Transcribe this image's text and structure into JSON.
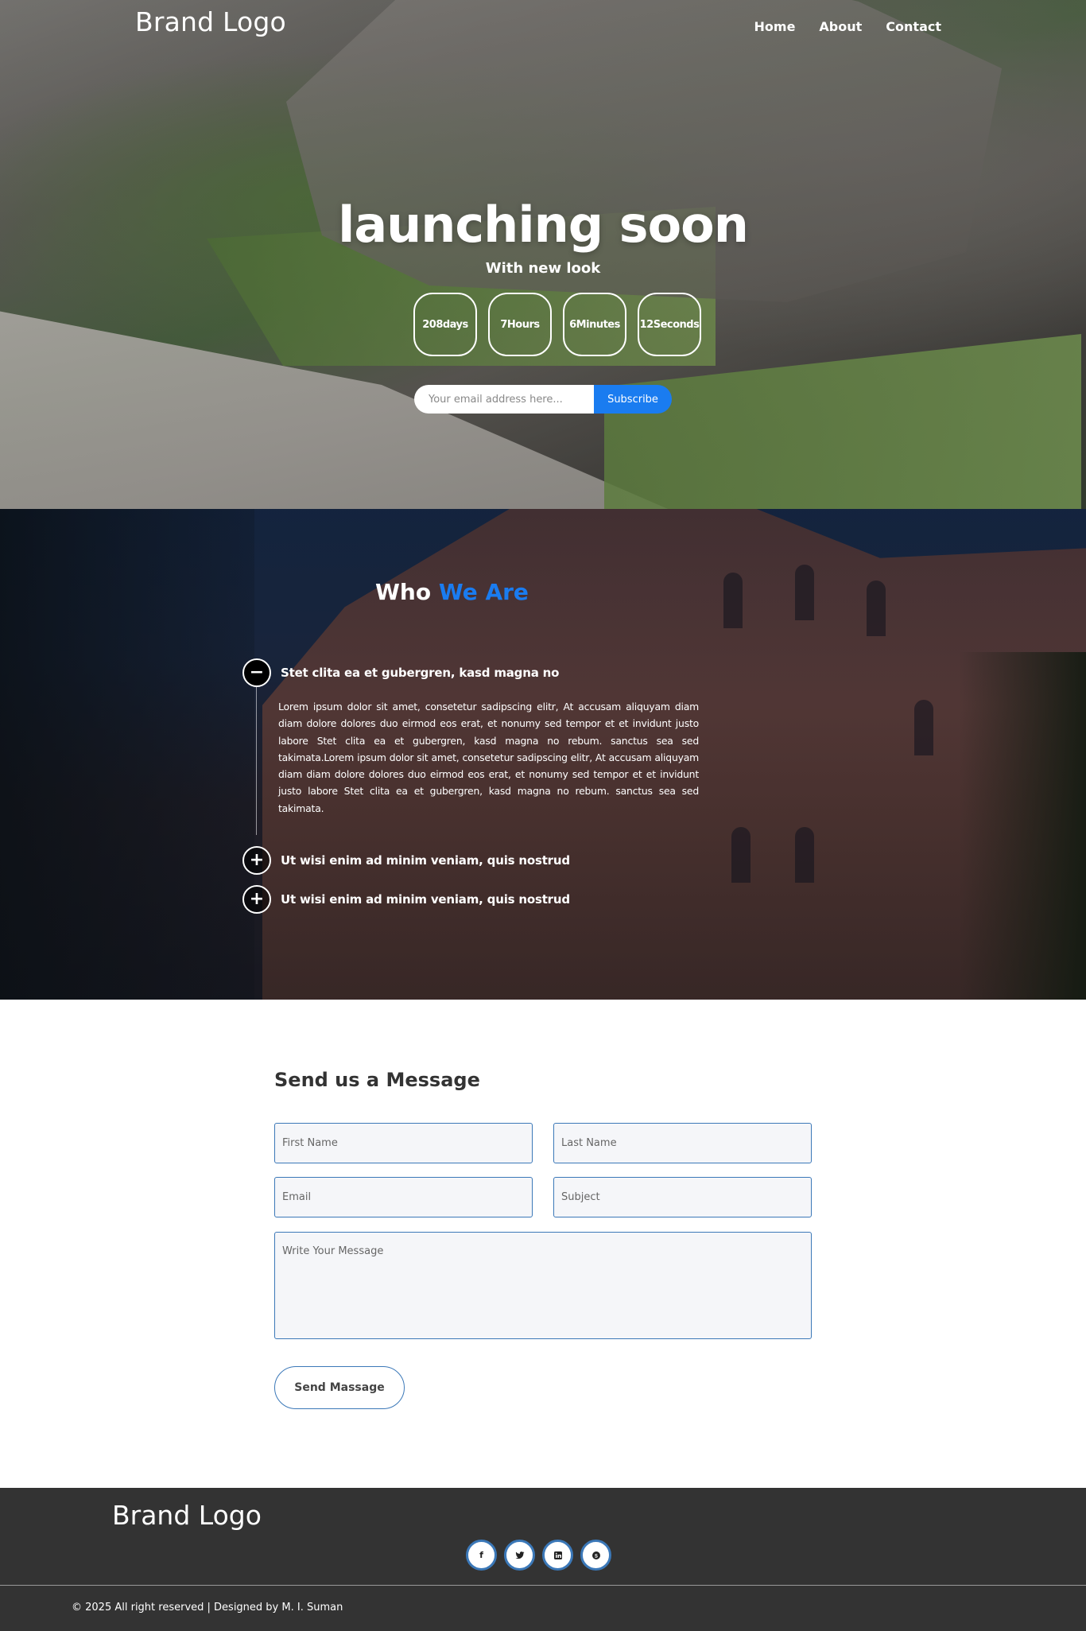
{
  "header": {
    "brand": "Brand Logo",
    "nav": [
      {
        "label": "Home"
      },
      {
        "label": "About"
      },
      {
        "label": "Contact"
      }
    ]
  },
  "hero": {
    "title": "launching soon",
    "subtitle": "With new look",
    "countdown": [
      {
        "label": "208days"
      },
      {
        "label": "7Hours"
      },
      {
        "label": "6Minutes"
      },
      {
        "label": "12Seconds"
      }
    ],
    "email_placeholder": "Your email address here...",
    "subscribe_label": "Subscribe"
  },
  "who": {
    "title_main": "Who",
    "title_accent": "We Are",
    "accent_color": "#1a7cf0",
    "items": [
      {
        "title": "Stet clita ea et gubergren, kasd magna no",
        "expanded": true,
        "body": "Lorem ipsum dolor sit amet, consetetur sadipscing elitr, At accusam aliquyam diam diam dolore dolores duo eirmod eos erat, et nonumy sed tempor et et invidunt justo labore Stet clita ea et gubergren, kasd magna no rebum. sanctus sea sed takimata.Lorem ipsum dolor sit amet, consetetur sadipscing elitr, At accusam aliquyam diam diam dolore dolores duo eirmod eos erat, et nonumy sed tempor et et invidunt justo labore Stet clita ea et gubergren, kasd magna no rebum. sanctus sea sed takimata.",
        "icon": "minus-icon"
      },
      {
        "title": "Ut wisi enim ad minim veniam, quis nostrud",
        "expanded": false,
        "icon": "plus-icon"
      },
      {
        "title": "Ut wisi enim ad minim veniam, quis nostrud",
        "expanded": false,
        "icon": "plus-icon"
      }
    ]
  },
  "contact": {
    "title": "Send us a Message",
    "first_name_placeholder": "First Name",
    "last_name_placeholder": "Last Name",
    "email_placeholder": "Email",
    "subject_placeholder": "Subject",
    "message_placeholder": "Write Your Message",
    "send_label": "Send Massage"
  },
  "footer": {
    "brand": "Brand Logo",
    "socials": [
      {
        "icon": "facebook-icon",
        "glyph": "f"
      },
      {
        "icon": "twitter-icon"
      },
      {
        "icon": "linkedin-icon"
      },
      {
        "icon": "skype-icon"
      }
    ],
    "copyright": "© 2025 All right reserved | Designed by M. I. Suman"
  }
}
